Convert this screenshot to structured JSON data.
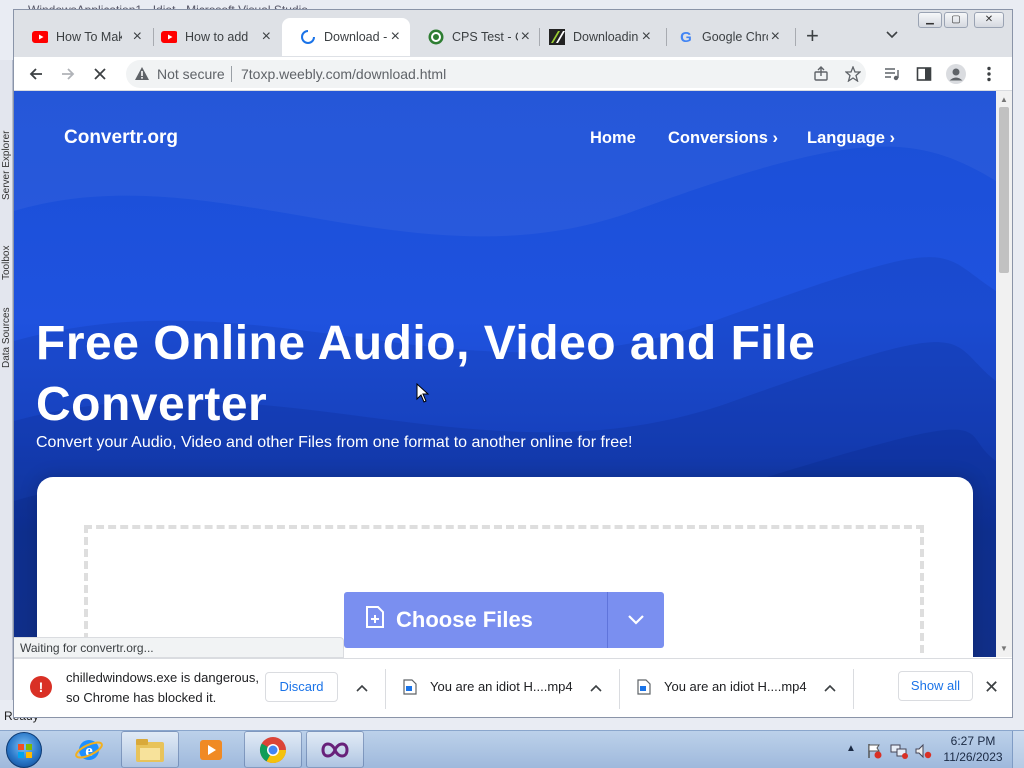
{
  "background_window": {
    "title": "WindowsApplication1 - Idiot - Microsoft Visual Studio",
    "side_tabs": [
      "Server Explorer",
      "Toolbox",
      "Data Sources"
    ],
    "status": "Ready"
  },
  "browser": {
    "tabs": [
      {
        "title": "How To Make",
        "favicon": "youtube-icon",
        "active": false
      },
      {
        "title": "How to add",
        "favicon": "youtube-icon",
        "active": false
      },
      {
        "title": "Download -",
        "favicon": "loading-spinner-icon",
        "active": true
      },
      {
        "title": "CPS Test - C",
        "favicon": "cps-icon",
        "active": false
      },
      {
        "title": "Downloading",
        "favicon": "download-site-icon",
        "active": false
      },
      {
        "title": "Google Chro",
        "favicon": "google-icon",
        "active": false
      }
    ],
    "omnibox": {
      "security_label": "Not secure",
      "url": "7toxp.weebly.com/download.html"
    },
    "status_bubble": "Waiting for convertr.org..."
  },
  "page": {
    "logo": "Convertr.org",
    "nav": [
      {
        "label": "Home",
        "has_chevron": false
      },
      {
        "label": "Conversions",
        "has_chevron": true
      },
      {
        "label": "Language",
        "has_chevron": true
      }
    ],
    "hero_title": "Free Online Audio, Video and File Converter",
    "hero_subtitle": "Convert your Audio, Video and other Files from one format to another online for free!",
    "choose_files_label": "Choose Files"
  },
  "download_shelf": {
    "blocked_item": {
      "text": "chilledwindows.exe is dangerous, so Chrome has blocked it.",
      "discard_label": "Discard"
    },
    "items": [
      {
        "name": "You are an idiot H....mp4"
      },
      {
        "name": "You are an idiot H....mp4"
      }
    ],
    "show_all_label": "Show all"
  },
  "taskbar": {
    "apps": [
      "internet-explorer-icon",
      "file-explorer-icon",
      "media-player-icon",
      "chrome-icon",
      "visual-studio-icon"
    ],
    "clock_time": "6:27 PM",
    "clock_date": "11/26/2023"
  },
  "colors": {
    "page_blue": "#1f52df",
    "button_purple": "#7a8ff0",
    "link_blue": "#1a73e8",
    "danger_red": "#d93025"
  }
}
